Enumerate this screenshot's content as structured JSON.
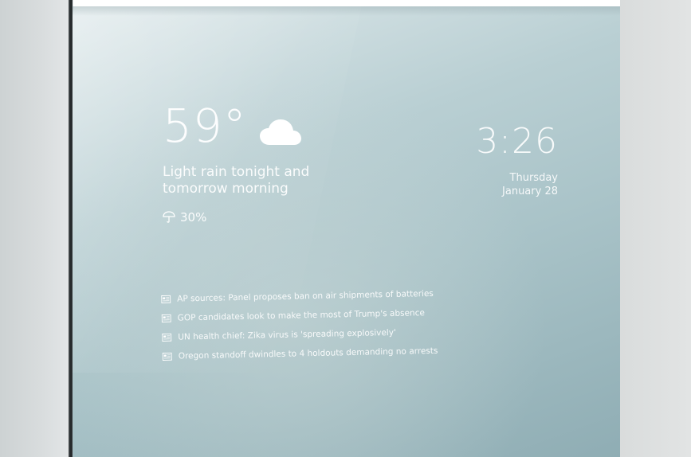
{
  "weather": {
    "temperature": "59°",
    "condition_icon": "cloud-icon",
    "condition": "Light rain tonight and tomorrow morning",
    "precip_icon": "umbrella-icon",
    "precip_chance": "30%"
  },
  "clock": {
    "time": "3:26",
    "day": "Thursday",
    "date": "January 28"
  },
  "news": {
    "icon": "news-icon",
    "headlines": [
      "AP sources: Panel proposes ban on air shipments of batteries",
      "GOP candidates look to make the most of Trump's absence",
      "UN health chief: Zika virus is 'spreading explosively'",
      "Oregon standoff dwindles to 4 holdouts demanding no arrests"
    ]
  },
  "colors": {
    "mirror_tint": "#a9c3c8",
    "text": "#ffffff",
    "frame": "#1f2325"
  }
}
